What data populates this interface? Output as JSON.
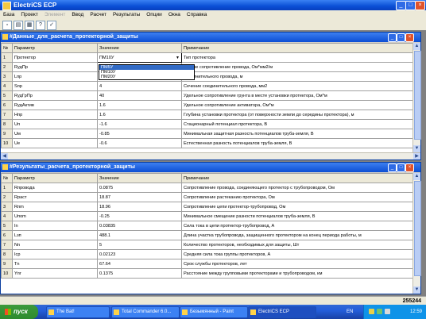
{
  "app": {
    "title": "ElectriCS ECP"
  },
  "menu": [
    "База",
    "Проект",
    "Элемент",
    "Ввод",
    "Расчет",
    "Результаты",
    "Опции",
    "Окна",
    "Справка"
  ],
  "window1": {
    "title": "#Данные_для_расчета_протекторной_защиты",
    "columns": [
      "№",
      "Параметр",
      "Значение",
      "Примечание"
    ],
    "rows": [
      [
        "1",
        "Протектор",
        "ПМ10У",
        "Тип протектора"
      ],
      [
        "2",
        "RудПр",
        "",
        "ельное сопротивление провода, Ом*мм2/м"
      ],
      [
        "3",
        "Lпр",
        "",
        "соединительного провода, м"
      ],
      [
        "4",
        "Sпр",
        "4",
        "Сечение соединительного провода, мм2"
      ],
      [
        "5",
        "RудГрПр",
        "40",
        "Удельное сопротивление грунта в месте установки протектора, Ом*м"
      ],
      [
        "6",
        "RудАктив",
        "1.6",
        "Удельное сопротивление активатора, Ом*м"
      ],
      [
        "7",
        "Hпр",
        "1.6",
        "Глубина установки протектора (от поверхности земли до середины протектора), м"
      ],
      [
        "8",
        "Uп",
        "-1.6",
        "Стационарный потенциал протектора, В"
      ],
      [
        "9",
        "Uм",
        "-0.85",
        "Минимальная защитная разность потенциалов труба-земля, В"
      ],
      [
        "10",
        "Uе",
        "-0.6",
        "Естественная разность потенциалов труба-земля, В"
      ]
    ],
    "dropdown_options": [
      "ПМ5У",
      "ПМ10У",
      "ПМ20У"
    ],
    "dropdown_selected": "ПМ5У"
  },
  "window2": {
    "title": "#Результаты_расчета_протекторной_защиты",
    "columns": [
      "№",
      "Параметр",
      "Значение",
      "Примечание"
    ],
    "rows": [
      [
        "1",
        "Rпровода",
        "0.0875",
        "Сопротивление провода, соединяющего протектор с трубопроводом, Ом"
      ],
      [
        "2",
        "Rраст",
        "18.87",
        "Сопротивление растеканию протектора, Ом"
      ],
      [
        "3",
        "Rпm",
        "18.96",
        "Сопротивление цепи протектор-трубопровод, Ом"
      ],
      [
        "4",
        "Uпоm",
        "-0.25",
        "Минимальное смещение разности потенциалов труба-земля, В"
      ],
      [
        "5",
        "In",
        "0.03835",
        "Сила тока в цепи протектор-трубопровод, А"
      ],
      [
        "6",
        "Lзп",
        "488.1",
        "Длина участка трубопровода, защищенного протектором на конец периода работы, м"
      ],
      [
        "7",
        "Nn",
        "5",
        "Количество протекторов, необходимых для защиты, Шт"
      ],
      [
        "8",
        "Icp",
        "0.02123",
        "Средняя сила тока группы протекторов, А"
      ],
      [
        "9",
        "Tn",
        "67.64",
        "Срок службы протекторов, лет"
      ],
      [
        "10",
        "Yпг",
        "0.1375",
        "Расстояние между групповыми протекторами и трубопроводом, км"
      ]
    ]
  },
  "status": {
    "counter": "255244"
  },
  "taskbar": {
    "start": "пуск",
    "tasks": [
      "The Bat!",
      "Total Commander 6.0...",
      "Безымянный - Paint",
      "ElectriCS ECP"
    ],
    "active_task": "ElectriCS ECP",
    "lang": "EN",
    "clock": "12:59"
  }
}
